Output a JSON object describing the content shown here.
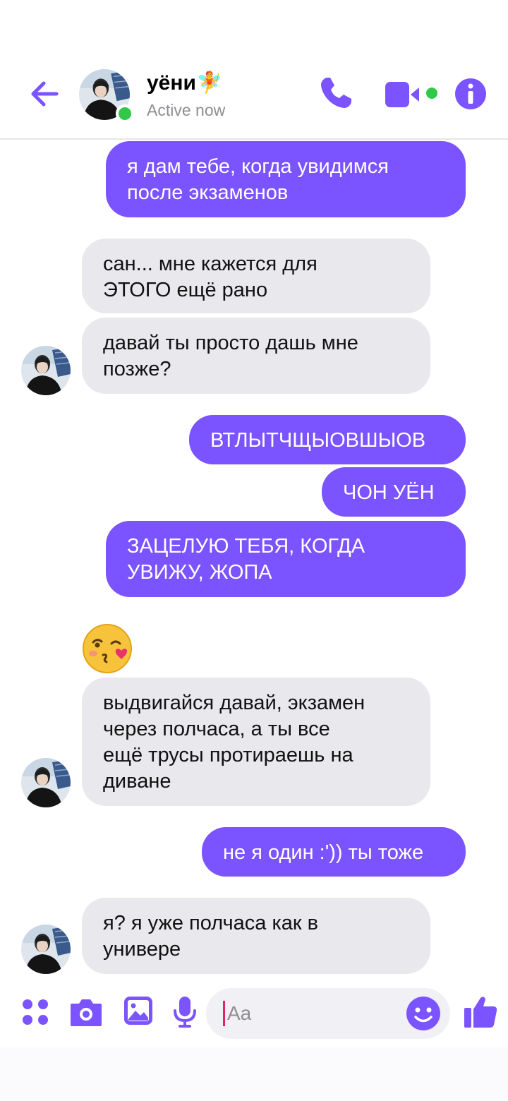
{
  "header": {
    "contact_name": "уёни",
    "status": "Active now",
    "accent": "#7b53ff",
    "online_color": "#31c84a"
  },
  "messages": [
    {
      "dir": "out",
      "text": "я дам тебе, когда увидимся\nпосле экзаменов"
    },
    {
      "dir": "in",
      "text": "сан... мне кажется для\nЭТОГО ещё рано"
    },
    {
      "dir": "in",
      "text": "давай ты просто дашь мне\nпозже?"
    },
    {
      "dir": "out",
      "text": "ВТЛЫТЧЩЫОВШЫОВ"
    },
    {
      "dir": "out",
      "text": "ЧОН УЁН"
    },
    {
      "dir": "out",
      "text": "ЗАЦЕЛУЮ ТЕБЯ, КОГДА\nУВИЖУ, ЖОПА"
    },
    {
      "dir": "in",
      "text": "выдвигайся давай, экзамен\nчерез полчаса, а ты все\nещё трусы протираешь на\nдиване"
    },
    {
      "dir": "out",
      "text": "не я один :')) ты тоже"
    },
    {
      "dir": "in",
      "text": "я? я уже полчаса как в\nунивере"
    }
  ],
  "reaction_emoji": "face-blowing-a-kiss",
  "composer": {
    "placeholder": "Aa"
  },
  "icons": {
    "back": "back-arrow-icon",
    "call": "phone-icon",
    "video": "video-camera-icon",
    "info": "info-icon",
    "apps": "apps-grid-icon",
    "camera": "camera-icon",
    "gallery": "image-icon",
    "mic": "microphone-icon",
    "emoji": "smiley-icon",
    "like": "thumbs-up-icon"
  }
}
